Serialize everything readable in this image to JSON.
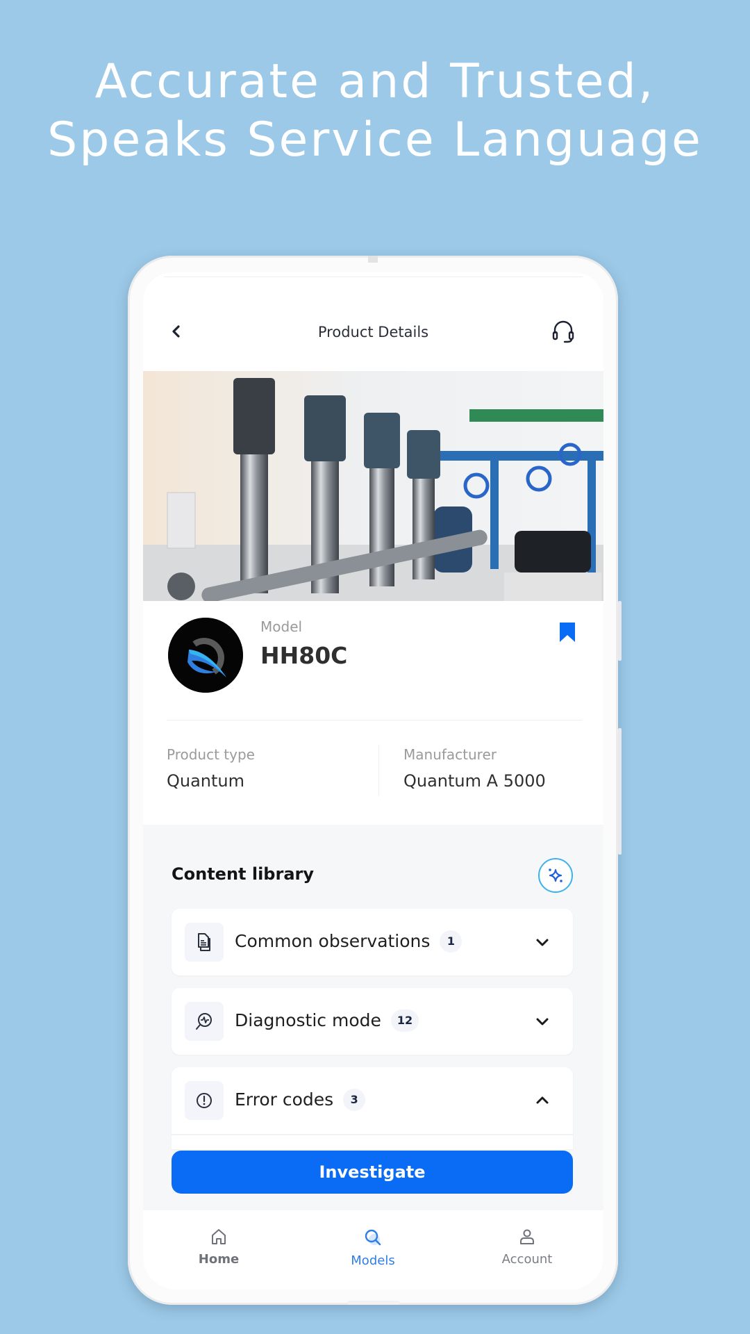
{
  "headline": {
    "line1": "Accurate and Trusted,",
    "line2": "Speaks Service Language"
  },
  "topbar": {
    "title": "Product Details",
    "back_icon": "chevron-left-icon",
    "support_icon": "headset-icon"
  },
  "hero": {
    "image_description": "industrial water pump station"
  },
  "product": {
    "model_label": "Model",
    "model_value": "HH80C",
    "bookmarked": true,
    "attributes": [
      {
        "label": "Product type",
        "value": "Quantum"
      },
      {
        "label": "Manufacturer",
        "value": "Quantum A 5000"
      }
    ]
  },
  "library": {
    "title": "Content library",
    "ai_icon": "sparkle-icon",
    "sections": [
      {
        "label": "Common observations",
        "count": "1",
        "icon": "document-icon",
        "expanded": false
      },
      {
        "label": "Diagnostic mode",
        "count": "12",
        "icon": "diagnostic-icon",
        "expanded": false
      },
      {
        "label": "Error codes",
        "count": "3",
        "icon": "alert-circle-icon",
        "expanded": true
      }
    ]
  },
  "cta": {
    "label": "Investigate"
  },
  "nav": {
    "items": [
      {
        "label": "Home",
        "icon": "home-icon",
        "active": false
      },
      {
        "label": "Models",
        "icon": "search-icon",
        "active": true
      },
      {
        "label": "Account",
        "icon": "user-icon",
        "active": false
      }
    ]
  },
  "colors": {
    "background": "#9cc9e7",
    "primary": "#0a6cf5",
    "active_nav": "#2f7ee8",
    "sparkle_ring": "#3db1f0"
  }
}
